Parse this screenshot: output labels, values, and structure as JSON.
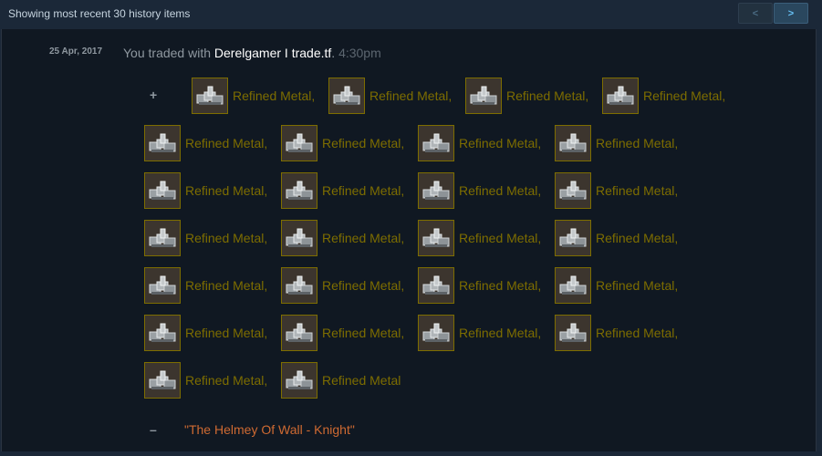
{
  "header": {
    "status": "Showing most recent 30 history items",
    "prev_label": "<",
    "next_label": ">"
  },
  "entry": {
    "date": "25 Apr, 2017",
    "prefix": "You traded with ",
    "partner": "Derelgamer I trade.tf",
    "separator": ".",
    "time": "4:30pm",
    "gained_sign": "+",
    "lost_sign": "–",
    "item_icon": "refined-metal-icon",
    "received_items": [
      "Refined Metal,",
      "Refined Metal,",
      "Refined Metal,",
      "Refined Metal,",
      "Refined Metal,",
      "Refined Metal,",
      "Refined Metal,",
      "Refined Metal,",
      "Refined Metal,",
      "Refined Metal,",
      "Refined Metal,",
      "Refined Metal,",
      "Refined Metal,",
      "Refined Metal,",
      "Refined Metal,",
      "Refined Metal,",
      "Refined Metal,",
      "Refined Metal,",
      "Refined Metal,",
      "Refined Metal,",
      "Refined Metal,",
      "Refined Metal,",
      "Refined Metal,",
      "Refined Metal,",
      "Refined Metal,",
      "Refined Metal"
    ],
    "lost_item": "\"The Helmey Of Wall - Knight\"",
    "colors": {
      "received_item": "#7d6d00",
      "lost_item": "#cf6a32",
      "partner": "#ffffff"
    }
  }
}
